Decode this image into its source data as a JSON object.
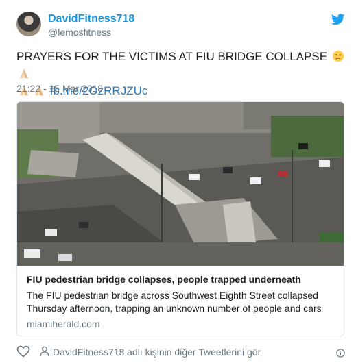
{
  "user": {
    "display_name": "DavidFitness718",
    "handle": "@lemosfitness",
    "avatar_icon": "profile-photo"
  },
  "tweet": {
    "text_main": "PRAYERS FOR THE VICTIMS AT FIU BRIDGE COLLAPSE",
    "emojis": [
      "sad-face-emoji",
      "praying-hands-emoji",
      "praying-hands-emoji",
      "praying-hands-emoji"
    ],
    "link": "fb.me/2OzRRJZUc",
    "timestamp": "21:22 - 15 Mar 2018"
  },
  "card": {
    "image_icon": "bridge-collapse-photo",
    "title": "FIU pedestrian bridge collapses, people trapped underneath",
    "description": "The FIU pedestrian bridge across Southwest Eighth Street collapsed Thursday afternoon, trapping an unknown number of people and cars",
    "domain": "miamiherald.com"
  },
  "footer": {
    "more_tweets": "DavidFitness718 adlı kişinin diğer Tweetlerini gör"
  },
  "colors": {
    "brand_blue": "#1b95e0",
    "link_blue": "#2b7bb9",
    "muted_gray": "#697882",
    "border": "#e1e8ed"
  }
}
